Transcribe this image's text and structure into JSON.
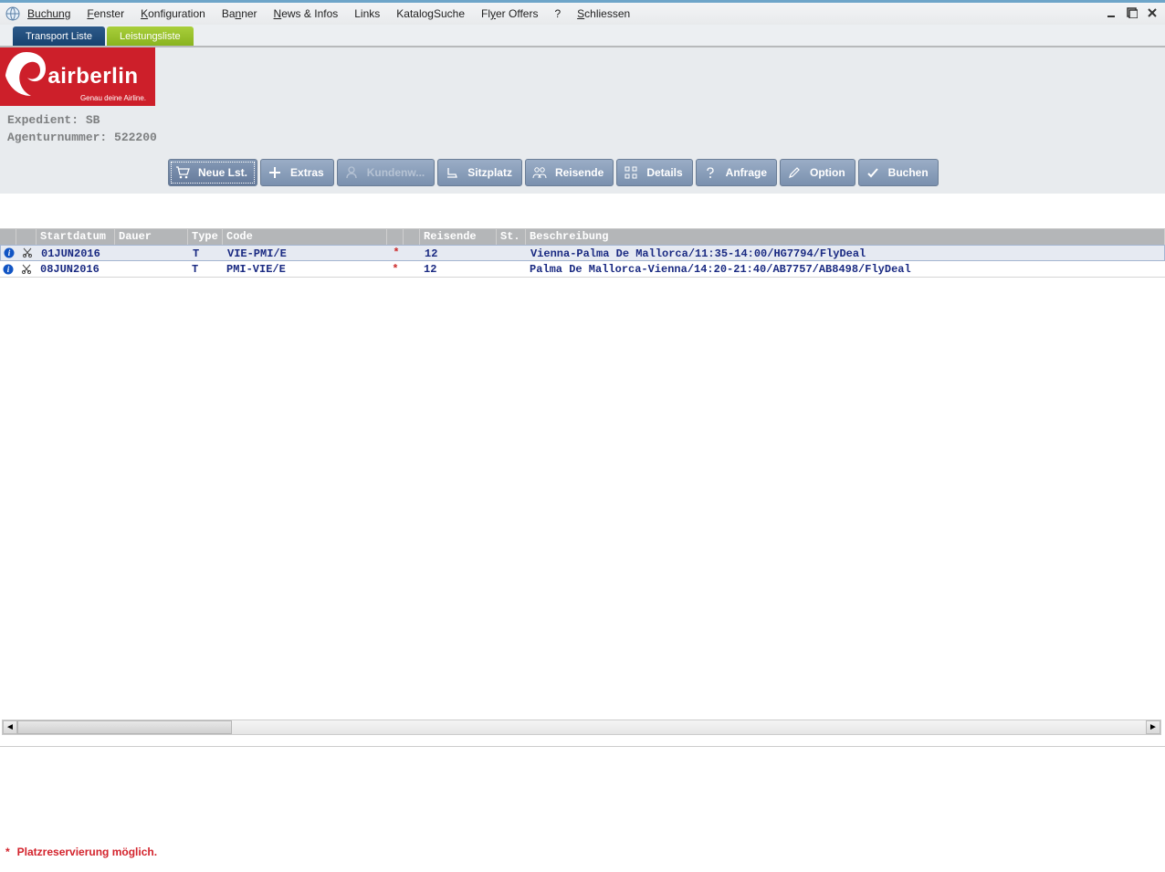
{
  "menu": [
    "Buchung",
    "Fenster",
    "Konfiguration",
    "Banner",
    "News & Infos",
    "Links",
    "KatalogSuche",
    "Flyer Offers",
    "?",
    "Schliessen"
  ],
  "tabs": {
    "transport": "Transport Liste",
    "leistung": "Leistungsliste"
  },
  "brand": {
    "name": "airberlin",
    "tagline": "Genau deine Airline."
  },
  "agent": {
    "line1_label": "Expedient:",
    "line1_value": "SB",
    "line2_label": "Agenturnummer:",
    "line2_value": "522200"
  },
  "toolbar": {
    "neue": "Neue Lst.",
    "extras": "Extras",
    "kunden": "Kundenw...",
    "sitz": "Sitzplatz",
    "reisende": "Reisende",
    "details": "Details",
    "anfrage": "Anfrage",
    "option": "Option",
    "buchen": "Buchen"
  },
  "columns": {
    "start": "Startdatum",
    "dauer": "Dauer",
    "type": "Type",
    "code": "Code",
    "reisende": "Reisende",
    "st": "St.",
    "besch": "Beschreibung"
  },
  "rows": [
    {
      "start": "01JUN2016",
      "dauer": "",
      "type": "T",
      "code": "VIE-PMI/E",
      "star": "*",
      "reisende": "12",
      "st": "",
      "desc": "Vienna-Palma De Mallorca/11:35-14:00/HG7794/FlyDeal"
    },
    {
      "start": "08JUN2016",
      "dauer": "",
      "type": "T",
      "code": "PMI-VIE/E",
      "star": "*",
      "reisende": "12",
      "st": "",
      "desc": "Palma De Mallorca-Vienna/14:20-21:40/AB7757/AB8498/FlyDeal"
    }
  ],
  "footer": {
    "asterisk": "*",
    "text": "Platzreservierung möglich."
  }
}
